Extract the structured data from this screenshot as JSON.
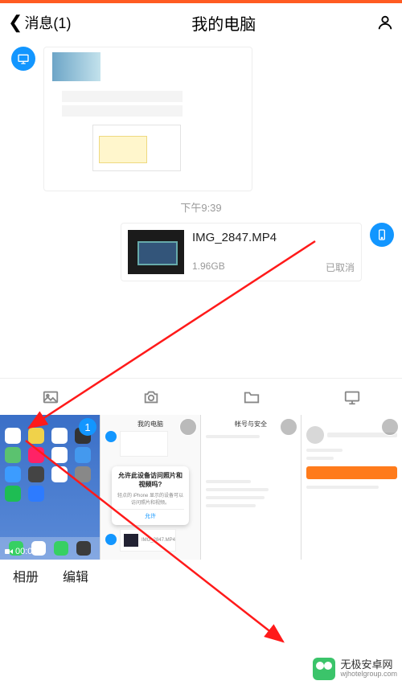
{
  "header": {
    "back_label": "消息(1)",
    "title": "我的电脑"
  },
  "chat": {
    "timestamp": "下午9:39",
    "file": {
      "name": "IMG_2847.MP4",
      "size": "1.96GB",
      "status": "已取消"
    }
  },
  "picker": {
    "selected_badge": "1",
    "video_duration": "00:07",
    "dialog": {
      "title": "允许此设备访问照片和视频吗?",
      "body": "轻点的 iPhone 显示的设备可以访问照片和视频。",
      "allow": "允许"
    },
    "ph3_header": "帐号与安全",
    "album_label": "相册",
    "edit_label": "编辑"
  },
  "watermark": {
    "name": "无极安卓网",
    "url": "wjhotelgroup.com"
  }
}
